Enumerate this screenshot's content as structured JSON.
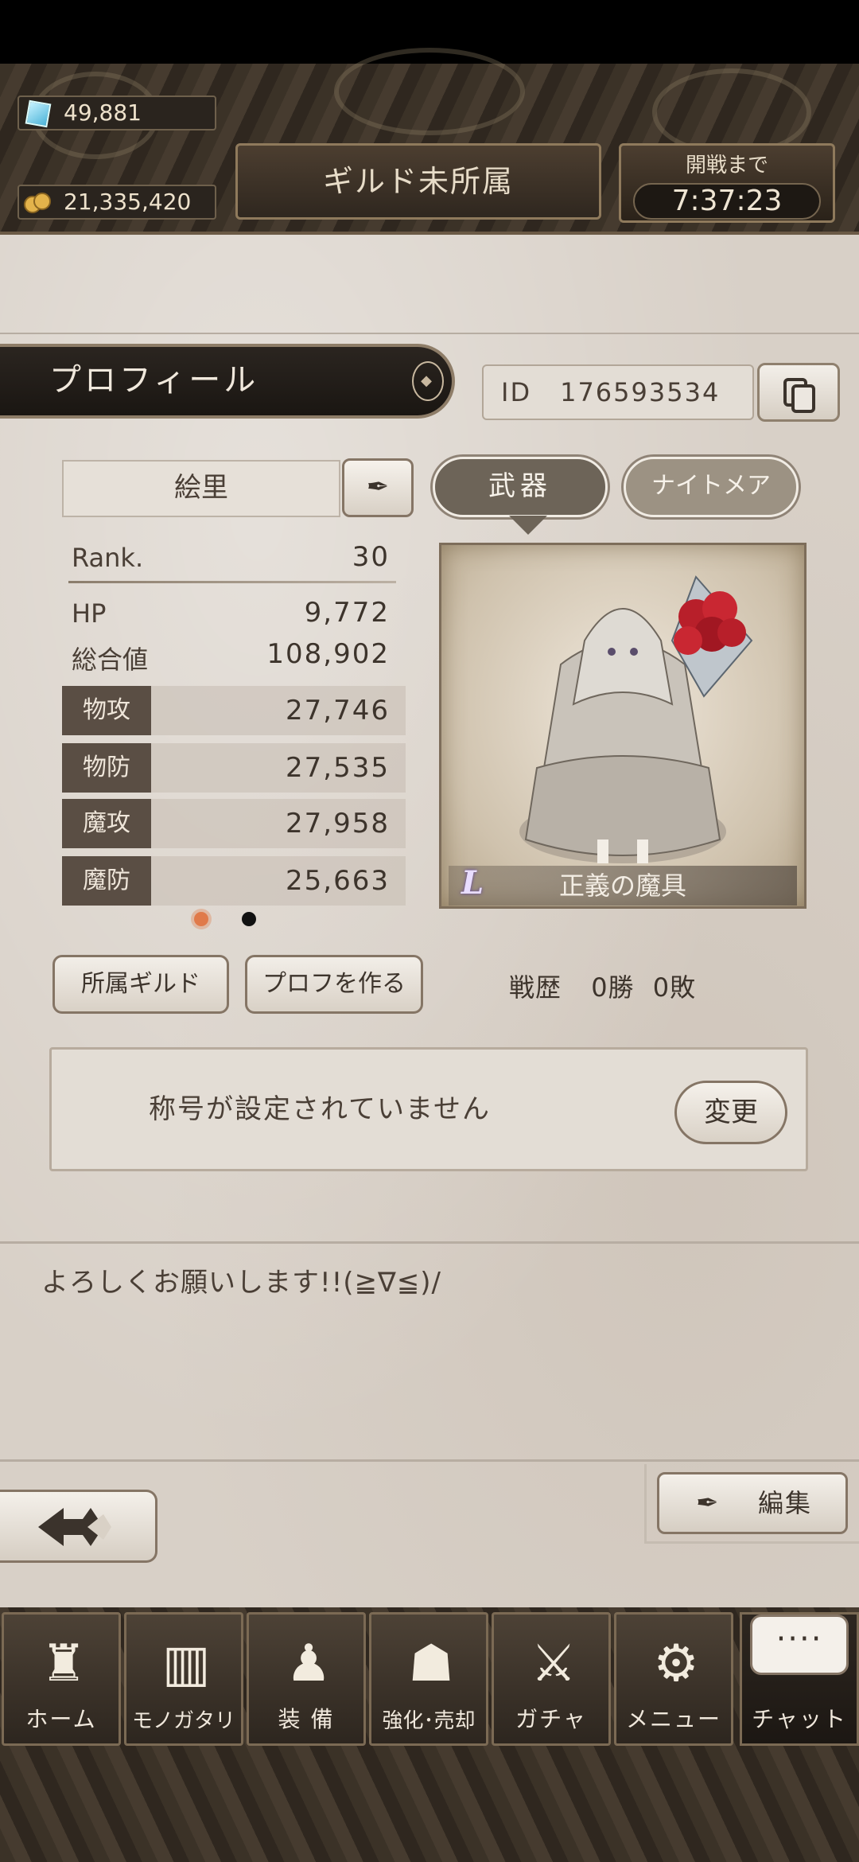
{
  "header": {
    "gems": "49,881",
    "coins": "21,335,420",
    "guild_status": "ギルド未所属",
    "battle_label": "開戦まで",
    "battle_time": "7:37:23"
  },
  "profile": {
    "tab_title": "プロフィール",
    "id_label": "ID",
    "id_value": "176593534",
    "name": "絵里",
    "rank_label": "Rank.",
    "rank_value": "30",
    "hp_label": "HP",
    "hp_value": "9,772",
    "total_label": "総合値",
    "total_value": "108,902",
    "stats": [
      {
        "label": "物攻",
        "value": "27,746"
      },
      {
        "label": "物防",
        "value": "27,535"
      },
      {
        "label": "魔攻",
        "value": "27,958"
      },
      {
        "label": "魔防",
        "value": "25,663"
      }
    ],
    "page_indicator": {
      "current": 1,
      "total": 2
    }
  },
  "weapon_panel": {
    "tab_weapon": "武器",
    "tab_nightmare": "ナイトメア",
    "rarity": "L",
    "weapon_name": "正義の魔具"
  },
  "actions": {
    "guild_button": "所属ギルド",
    "make_profile_button": "プロフを作る",
    "record_label": "戦歴",
    "wins": "0勝",
    "losses": "0敗"
  },
  "title_box": {
    "text": "称号が設定されていません",
    "change_button": "変更"
  },
  "comment": "よろしくお願いします!!(≧∇≦)/",
  "edit_button": "編集",
  "nav": [
    {
      "label": "ホーム",
      "icon": "castle-icon"
    },
    {
      "label": "モノガタリ",
      "icon": "book-icon"
    },
    {
      "label": "装 備",
      "icon": "equipment-icon"
    },
    {
      "label": "強化･売却",
      "icon": "mask-icon"
    },
    {
      "label": "ガチャ",
      "icon": "swords-icon"
    },
    {
      "label": "メニュー",
      "icon": "gear-icon"
    },
    {
      "label": "チャット",
      "icon": "chat-icon"
    }
  ],
  "chat_bubble": "····",
  "colors": {
    "accent_dot": "#e07a4a",
    "panel_dark": "#2f271f",
    "paper": "#d8d0c7"
  }
}
